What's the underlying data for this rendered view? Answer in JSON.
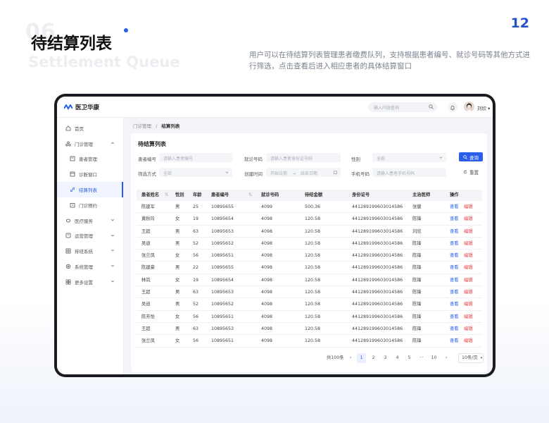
{
  "page": {
    "number": "12",
    "ghost_number": "06",
    "title": "待结算列表",
    "title_en": "Settlement Queue",
    "description": "用户可以在待结算列表管理患者缴费队列，支持根据患者编号、就诊号码等其他方式进行筛选，点击查看后进入相应患者的具体结算窗口"
  },
  "app": {
    "name": "医卫华康",
    "search_placeholder": "输入内容查询",
    "user_name": "刘欣",
    "accent": "#2b5ee8",
    "danger": "#e8454a"
  },
  "sidebar": {
    "items": [
      {
        "label": "首页",
        "icon": "home-icon"
      },
      {
        "label": "门诊管理",
        "icon": "clinic-icon",
        "expanded": true
      },
      {
        "label": "患者管理",
        "icon": "patient-icon",
        "sub": true
      },
      {
        "label": "诊断窗口",
        "icon": "diagnosis-icon",
        "sub": true
      },
      {
        "label": "结算列表",
        "icon": "link-icon",
        "sub": true,
        "active": true
      },
      {
        "label": "门诊预约",
        "icon": "calendar-icon",
        "sub": true
      },
      {
        "label": "医疗服务",
        "icon": "medical-icon"
      },
      {
        "label": "运营管理",
        "icon": "operation-icon"
      },
      {
        "label": "排班系统",
        "icon": "schedule-icon"
      },
      {
        "label": "系统管理",
        "icon": "settings-icon"
      },
      {
        "label": "更多设置",
        "icon": "more-icon"
      }
    ]
  },
  "breadcrumb": {
    "parent": "门诊管理",
    "separator": "/",
    "current": "结算列表"
  },
  "panel": {
    "title": "待结算列表"
  },
  "filters": {
    "patient_no": {
      "label": "患者编号",
      "placeholder": "请输入患者编号"
    },
    "visit_no": {
      "label": "就诊号码",
      "placeholder": "请输入患者身份证号码"
    },
    "gender": {
      "label": "性别",
      "value": "全部"
    },
    "filter_mode": {
      "label": "筛选方式",
      "value": "全部"
    },
    "created_time": {
      "label": "创建时间",
      "start": "开始日期",
      "arrow": "→",
      "end": "结束日期"
    },
    "phone": {
      "label": "手机号码",
      "placeholder": "请输入患者手机号码"
    },
    "search_button": "查询",
    "reset_button": "重置"
  },
  "table": {
    "columns": [
      "患者姓名",
      "性别",
      "年龄",
      "患者编号",
      "就诊号码",
      "待结金额",
      "身份证号",
      "主治医师",
      "操作"
    ],
    "view_label": "查看",
    "edit_label": "编辑",
    "rows": [
      [
        "陈建军",
        "男",
        "25",
        "10895655",
        "4099",
        "500.36",
        "441289199603014586",
        "张健"
      ],
      [
        "黄秋玲",
        "女",
        "19",
        "10895654",
        "4098",
        "120.58",
        "441289199603014586",
        "陈锋"
      ],
      [
        "王超",
        "男",
        "63",
        "10895653",
        "4098",
        "120.58",
        "441289199603014586",
        "刘欣"
      ],
      [
        "吴迪",
        "男",
        "52",
        "10895652",
        "4098",
        "120.58",
        "441289199603014586",
        "陈锋"
      ],
      [
        "张兰凤",
        "女",
        "56",
        "10895651",
        "4098",
        "120.58",
        "441289199603014586",
        "陈锋"
      ],
      [
        "陈建豪",
        "男",
        "22",
        "10895655",
        "4098",
        "120.58",
        "441289199603014586",
        "陈锋"
      ],
      [
        "林岚",
        "女",
        "19",
        "10895654",
        "4098",
        "120.58",
        "441289199603014586",
        "陈锋"
      ],
      [
        "王超",
        "男",
        "63",
        "10895653",
        "4098",
        "120.58",
        "441289199603014586",
        "陈锋"
      ],
      [
        "吴迪",
        "男",
        "52",
        "10895652",
        "4098",
        "120.58",
        "441289199603014586",
        "陈锋"
      ],
      [
        "陈芳怡",
        "女",
        "56",
        "10895651",
        "4098",
        "120.58",
        "441289199603014586",
        "陈锋"
      ],
      [
        "王超",
        "男",
        "63",
        "10895653",
        "4098",
        "120.58",
        "441289199603014586",
        "陈锋"
      ],
      [
        "张兰凤",
        "女",
        "56",
        "10895651",
        "4098",
        "120.58",
        "441289199603014586",
        "陈锋"
      ]
    ]
  },
  "pagination": {
    "total": "共100条",
    "prev": "‹",
    "pages": [
      "1",
      "2",
      "3",
      "4",
      "5"
    ],
    "ellipsis": "···",
    "last": "10",
    "next": "›",
    "page_size": "10条/页",
    "current": "1"
  }
}
